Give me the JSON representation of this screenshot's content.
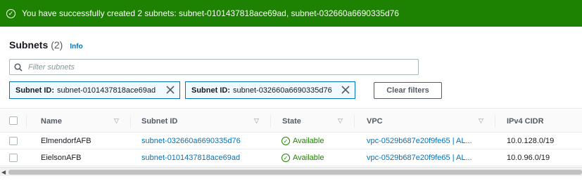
{
  "flash": {
    "message": "You have successfully created 2 subnets: subnet-0101437818ace69ad, subnet-032660a6690335d76",
    "icon": "success-check-icon"
  },
  "header": {
    "title": "Subnets",
    "count": "(2)",
    "info_label": "Info"
  },
  "search": {
    "placeholder": "Filter subnets"
  },
  "filters": [
    {
      "key": "Subnet ID:",
      "value": "subnet-0101437818ace69ad"
    },
    {
      "key": "Subnet ID:",
      "value": "subnet-032660a6690335d76"
    }
  ],
  "clear_filters_label": "Clear filters",
  "table": {
    "columns": [
      "Name",
      "Subnet ID",
      "State",
      "VPC",
      "IPv4 CIDR"
    ],
    "rows": [
      {
        "name": "ElmendorfAFB",
        "subnet_id": "subnet-032660a6690335d76",
        "state": "Available",
        "vpc": "vpc-0529b687e20f9fe65 | AL...",
        "cidr": "10.0.128.0/19"
      },
      {
        "name": "EielsonAFB",
        "subnet_id": "subnet-0101437818ace69ad",
        "state": "Available",
        "vpc": "vpc-0529b687e20f9fe65 | AL...",
        "cidr": "10.0.96.0/19"
      }
    ]
  },
  "colors": {
    "success": "#1d8102",
    "link": "#0073bb"
  }
}
